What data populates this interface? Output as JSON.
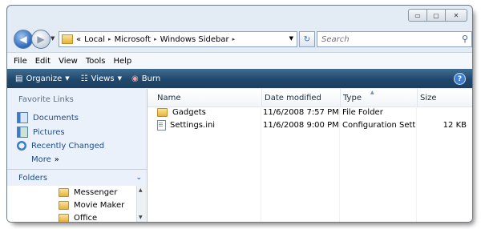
{
  "window": {
    "caption_buttons": [
      {
        "name": "minimize",
        "glyph": "▭"
      },
      {
        "name": "maximize",
        "glyph": "▢"
      },
      {
        "name": "close",
        "glyph": "✕"
      }
    ]
  },
  "address": {
    "overflow": "«",
    "crumbs": [
      "Local",
      "Microsoft",
      "Windows Sidebar"
    ],
    "separator": "▸"
  },
  "search": {
    "placeholder": "Search"
  },
  "menu": [
    "File",
    "Edit",
    "View",
    "Tools",
    "Help"
  ],
  "toolbar": {
    "organize": "Organize",
    "views": "Views",
    "burn": "Burn",
    "help": "?"
  },
  "nav": {
    "favorite_title": "Favorite Links",
    "links": [
      "Documents",
      "Pictures",
      "Recently Changed"
    ],
    "more": "More",
    "more_glyph": "»",
    "folders_label": "Folders",
    "folders_chevron": "⌄",
    "tree": [
      "Messenger",
      "Movie Maker",
      "Office"
    ]
  },
  "columns": [
    "Name",
    "Date modified",
    "Type",
    "Size"
  ],
  "files": [
    {
      "name": "Gadgets",
      "date": "11/6/2008 7:57 PM",
      "type": "File Folder",
      "size": "",
      "kind": "folder"
    },
    {
      "name": "Settings.ini",
      "date": "11/6/2008 9:00 PM",
      "type": "Configuration Sett...",
      "size": "12 KB",
      "kind": "file"
    }
  ],
  "colors": {
    "toolbar": "#20486c",
    "link": "#1e4b8a",
    "nav_bg": "#eaf1fa"
  }
}
